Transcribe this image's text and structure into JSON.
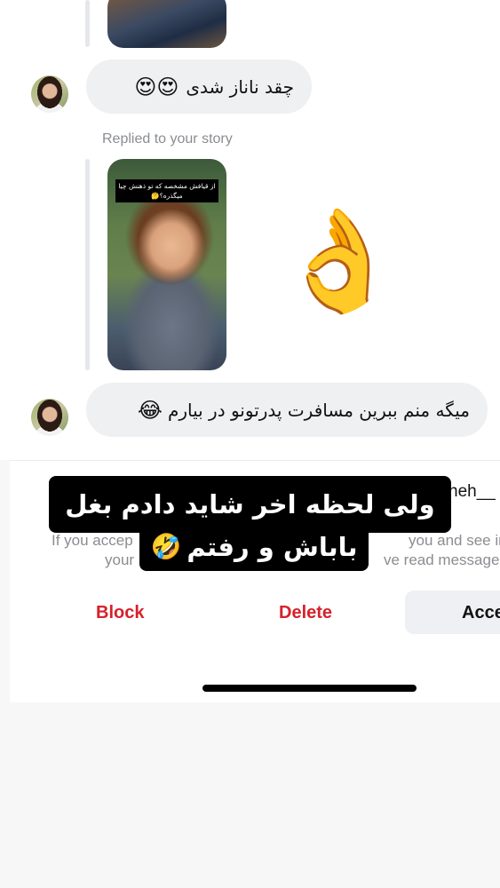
{
  "thread": {
    "message_1": {
      "text": "چقد ناناز شدی",
      "emojis": "😍😍"
    },
    "replied_label": "Replied to your story",
    "story_caption": "از قیافش مشخصه که تو ذهنش چیا میگذره؟🤔",
    "ok_emoji": "👌",
    "message_2": {
      "text": "میگه منم ببرین مسافرت پدرتونو در بیارم",
      "emoji": "😂"
    }
  },
  "request": {
    "username_partial": "neh__",
    "info_left_1": "If you accep",
    "info_left_2": "your",
    "info_right_1": "you and see info",
    "info_right_2": "ve read messages",
    "block_label": "Block",
    "delete_label": "Delete",
    "accept_label": "Acce"
  },
  "overlay_caption": {
    "line_1": "ولی لحظه اخر شاید دادم بغل",
    "line_2": "باباش و رفتم",
    "emoji": "🤣"
  },
  "colors": {
    "danger": "#d6212c",
    "bubble": "#eff0f2",
    "muted": "#8a8d91"
  }
}
